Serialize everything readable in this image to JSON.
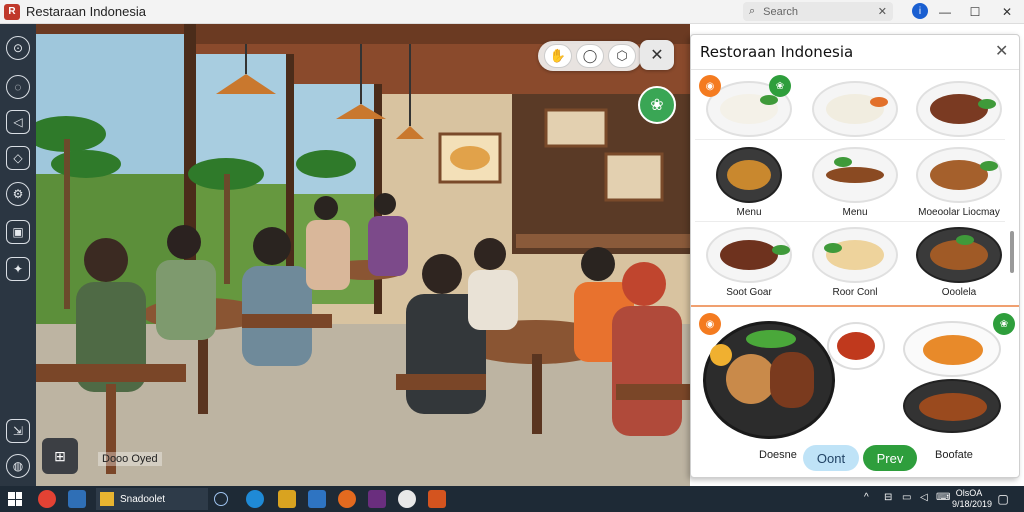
{
  "window": {
    "title": "Restaraan Indonesia",
    "app_icon": "restaurant-app-icon",
    "search_placeholder": "Search",
    "profile_initial": "i",
    "minimize": "—",
    "maximize": "☐",
    "close": "✕"
  },
  "sidebar": {
    "items": [
      {
        "icon": "compass-icon",
        "glyph": "⊙"
      },
      {
        "icon": "location-icon",
        "glyph": "◌"
      },
      {
        "icon": "megaphone-icon",
        "glyph": "◁"
      },
      {
        "icon": "tag-icon",
        "glyph": "◇"
      },
      {
        "icon": "settings-icon",
        "glyph": "⚙"
      },
      {
        "icon": "image-icon",
        "glyph": "▣"
      },
      {
        "icon": "puzzle-icon",
        "glyph": "✦"
      },
      {
        "icon": "export-icon",
        "glyph": "⇲"
      },
      {
        "icon": "globe-icon",
        "glyph": "◍"
      }
    ]
  },
  "scene": {
    "tools": [
      {
        "icon": "hand-icon",
        "glyph": "✋"
      },
      {
        "icon": "shield-icon",
        "glyph": "◯"
      },
      {
        "icon": "cube-icon",
        "glyph": "⬡"
      }
    ],
    "close": "✕",
    "leaf_badge": "❀",
    "bottom_button_glyph": "⊞",
    "caption": "Dooo Oyed"
  },
  "panel": {
    "title": "Restoraan Indonesia",
    "close": "✕",
    "items": [
      {
        "label": "",
        "dish": "rice-dish"
      },
      {
        "label": "",
        "dish": "rice-plate"
      },
      {
        "label": "",
        "dish": "rendang"
      },
      {
        "label": "Menu",
        "dish": "curry-bowl"
      },
      {
        "label": "Menu",
        "dish": "satay"
      },
      {
        "label": "Moeoolar Liocmay",
        "dish": "fried-fish"
      },
      {
        "label": "Soot Goar",
        "dish": "beef-rendang"
      },
      {
        "label": "Roor Conl",
        "dish": "chicken-plate"
      },
      {
        "label": "Ooolela",
        "dish": "grilled-fish"
      }
    ],
    "featured": {
      "left_label": "Doesne",
      "right_label": "Boofate",
      "cont_label": "Oont",
      "prev_label": "Prev"
    },
    "colors": {
      "accent_orange": "#f47b20",
      "accent_green": "#2e9e3c",
      "cont_blue": "#bfe3f7"
    }
  },
  "taskbar": {
    "app_label": "Snadoolet",
    "clock_time": "OlsOA",
    "clock_date": "9/18/2019",
    "apps": [
      {
        "icon": "chrome-icon"
      },
      {
        "icon": "monitor-icon"
      },
      {
        "icon": "folder-icon"
      },
      {
        "icon": "search-circle-icon"
      },
      {
        "icon": "edge-icon"
      },
      {
        "icon": "files-icon"
      },
      {
        "icon": "store-icon"
      },
      {
        "icon": "chrome-icon-2"
      },
      {
        "icon": "slack-icon"
      },
      {
        "icon": "soccer-icon"
      },
      {
        "icon": "restaurant-taskbar-icon"
      }
    ]
  }
}
